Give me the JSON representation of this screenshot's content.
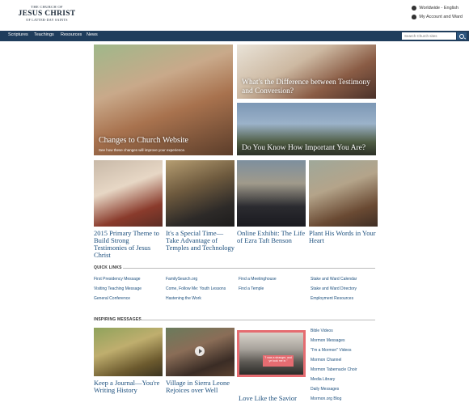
{
  "logo": {
    "line1": "THE CHURCH OF",
    "line2": "JESUS CHRIST",
    "line3": "OF LATTER-DAY SAINTS"
  },
  "topright": {
    "language": "Worldwide - English",
    "account": "My Account and Ward"
  },
  "nav": [
    "Scriptures",
    "Teachings",
    "Resources",
    "News"
  ],
  "search": {
    "placeholder": "Search Church sites"
  },
  "hero": {
    "main_title": "Changes to Church Website",
    "main_sub": "See how these changes will improve your experience.",
    "right_top": "What's the Difference between Testimony and Conversion?",
    "right_bottom": "Do You Know How Important You Are?"
  },
  "tiles": [
    "2015 Primary Theme to Build Strong Testimonies of Jesus Christ",
    "It's a Special Time—Take Advantage of Temples and Technology",
    "Online Exhibit: The Life of Ezra Taft Benson",
    "Plant His Words in Your Heart"
  ],
  "quick_links": {
    "title": "QUICK LINKS",
    "col1": [
      "First Presidency Message",
      "Visiting Teaching Message",
      "General Conference"
    ],
    "col2": [
      "FamilySearch.org",
      "Come, Follow Me: Youth Lessons",
      "Hastening the Work"
    ],
    "col3": [
      "Find a Meetinghouse",
      "Find a Temple"
    ],
    "col4": [
      "Stake and Ward Calendar",
      "Stake and Ward Directory",
      "Employment Resources"
    ]
  },
  "inspiring": {
    "title": "INSPIRING MESSAGES",
    "titles": [
      "Keep a Journal—You're Writing History",
      "Village in Sierra Leone Rejoices over Well",
      "Love Like the Savior"
    ],
    "quote_text": "\"I was a stranger, and ye took me in.\"",
    "side_links": [
      "Bible Videos",
      "Mormon Messages",
      "\"I'm a Mormon\" Videos",
      "Mormon Channel",
      "Mormon Tabernacle Choir",
      "Media Library",
      "Daily Messages",
      "Mormon.org Blog"
    ]
  }
}
